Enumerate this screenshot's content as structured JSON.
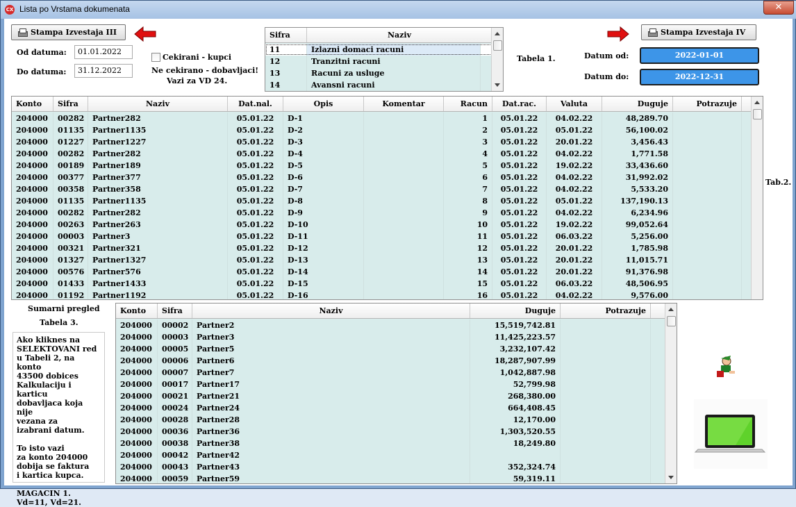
{
  "window": {
    "title": "Lista po Vrstama dokumenata",
    "close_glyph": "✕",
    "title_icon": "app-icon"
  },
  "buttons": {
    "stampa3": "Stampa Izvestaja III",
    "stampa4": "Stampa Izvestaja IV"
  },
  "filters": {
    "od_label": "Od datuma:",
    "od_value": "01.01.2022",
    "do_label": "Do datuma:",
    "do_value": "31.12.2022",
    "checkbox_label": "Cekirani - kupci",
    "note_line1": "Ne cekirano - dobavljaci!",
    "note_line2": "Vazi za VD 24."
  },
  "table1": {
    "caption": "Tabela 1.",
    "headers": [
      "Sifra",
      "Naziv"
    ],
    "rows": [
      [
        "11",
        "Izlazni domaci racuni"
      ],
      [
        "12",
        "Tranzitni racuni"
      ],
      [
        "13",
        "Racuni za usluge"
      ],
      [
        "14",
        "Avansni racuni"
      ]
    ]
  },
  "datum_range": {
    "od_label": "Datum od:",
    "od_value": "2022-01-01",
    "do_label": "Datum do:",
    "do_value": "2022-12-31"
  },
  "table2": {
    "caption": "Tab.2.",
    "headers": [
      "Konto",
      "Sifra",
      "Naziv",
      "Dat.nal.",
      "Opis",
      "Komentar",
      "Racun",
      "Dat.rac.",
      "Valuta",
      "Duguje",
      "Potrazuje"
    ],
    "rows": [
      [
        "204000",
        "00282",
        "Partner282",
        "05.01.22",
        "D-1",
        "",
        "1",
        "05.01.22",
        "04.02.22",
        "48,289.70",
        ""
      ],
      [
        "204000",
        "01135",
        "Partner1135",
        "05.01.22",
        "D-2",
        "",
        "2",
        "05.01.22",
        "05.01.22",
        "56,100.02",
        ""
      ],
      [
        "204000",
        "01227",
        "Partner1227",
        "05.01.22",
        "D-3",
        "",
        "3",
        "05.01.22",
        "20.01.22",
        "3,456.43",
        ""
      ],
      [
        "204000",
        "00282",
        "Partner282",
        "05.01.22",
        "D-4",
        "",
        "4",
        "05.01.22",
        "04.02.22",
        "1,771.58",
        ""
      ],
      [
        "204000",
        "00189",
        "Partner189",
        "05.01.22",
        "D-5",
        "",
        "5",
        "05.01.22",
        "19.02.22",
        "33,436.60",
        ""
      ],
      [
        "204000",
        "00377",
        "Partner377",
        "05.01.22",
        "D-6",
        "",
        "6",
        "05.01.22",
        "04.02.22",
        "31,992.02",
        ""
      ],
      [
        "204000",
        "00358",
        "Partner358",
        "05.01.22",
        "D-7",
        "",
        "7",
        "05.01.22",
        "04.02.22",
        "5,533.20",
        ""
      ],
      [
        "204000",
        "01135",
        "Partner1135",
        "05.01.22",
        "D-8",
        "",
        "8",
        "05.01.22",
        "05.01.22",
        "137,190.13",
        ""
      ],
      [
        "204000",
        "00282",
        "Partner282",
        "05.01.22",
        "D-9",
        "",
        "9",
        "05.01.22",
        "04.02.22",
        "6,234.96",
        ""
      ],
      [
        "204000",
        "00263",
        "Partner263",
        "05.01.22",
        "D-10",
        "",
        "10",
        "05.01.22",
        "19.02.22",
        "99,052.64",
        ""
      ],
      [
        "204000",
        "00003",
        "Partner3",
        "05.01.22",
        "D-11",
        "",
        "11",
        "05.01.22",
        "06.03.22",
        "5,256.00",
        ""
      ],
      [
        "204000",
        "00321",
        "Partner321",
        "05.01.22",
        "D-12",
        "",
        "12",
        "05.01.22",
        "20.01.22",
        "1,785.98",
        ""
      ],
      [
        "204000",
        "01327",
        "Partner1327",
        "05.01.22",
        "D-13",
        "",
        "13",
        "05.01.22",
        "20.01.22",
        "11,015.71",
        ""
      ],
      [
        "204000",
        "00576",
        "Partner576",
        "05.01.22",
        "D-14",
        "",
        "14",
        "05.01.22",
        "20.01.22",
        "91,376.98",
        ""
      ],
      [
        "204000",
        "01433",
        "Partner1433",
        "05.01.22",
        "D-15",
        "",
        "15",
        "05.01.22",
        "06.03.22",
        "48,506.95",
        ""
      ],
      [
        "204000",
        "01192",
        "Partner1192",
        "05.01.22",
        "D-16",
        "",
        "16",
        "05.01.22",
        "04.02.22",
        "9,576.00",
        ""
      ]
    ]
  },
  "sumarni": {
    "title": "Sumarni pregled",
    "caption": "Tabela 3."
  },
  "table3": {
    "headers": [
      "Konto",
      "Sifra",
      "Naziv",
      "Duguje",
      "Potrazuje"
    ],
    "rows": [
      [
        "204000",
        "00002",
        "Partner2",
        "15,519,742.81",
        ""
      ],
      [
        "204000",
        "00003",
        "Partner3",
        "11,425,223.57",
        ""
      ],
      [
        "204000",
        "00005",
        "Partner5",
        "3,232,107.42",
        ""
      ],
      [
        "204000",
        "00006",
        "Partner6",
        "18,287,907.99",
        ""
      ],
      [
        "204000",
        "00007",
        "Partner7",
        "1,042,887.98",
        ""
      ],
      [
        "204000",
        "00017",
        "Partner17",
        "52,799.98",
        ""
      ],
      [
        "204000",
        "00021",
        "Partner21",
        "268,380.00",
        ""
      ],
      [
        "204000",
        "00024",
        "Partner24",
        "664,408.45",
        ""
      ],
      [
        "204000",
        "00028",
        "Partner28",
        "12,170.00",
        ""
      ],
      [
        "204000",
        "00036",
        "Partner36",
        "1,303,520.55",
        ""
      ],
      [
        "204000",
        "00038",
        "Partner38",
        "18,249.80",
        ""
      ],
      [
        "204000",
        "00042",
        "Partner42",
        "",
        ""
      ],
      [
        "204000",
        "00043",
        "Partner43",
        "352,324.74",
        ""
      ],
      [
        "204000",
        "00059",
        "Partner59",
        "59,319.11",
        ""
      ]
    ]
  },
  "help_note": "Ako kliknes na\nSELEKTOVANI red\nu Tabeli 2, na konto\n43500 dobices\nKalkulaciju i karticu\ndobavljaca koja nije\nvezana za\nizabrani datum.\n\nTo isto vazi\nza konto 204000\ndobija se faktura\ni kartica kupca.\n\nMAGACIN 1.\nVd=11, Vd=21.",
  "colors": {
    "row_bg": "#d8eceb",
    "selected_row": "#ffffff",
    "blue_date": "#3d95e8",
    "arrow": "#e01010"
  }
}
